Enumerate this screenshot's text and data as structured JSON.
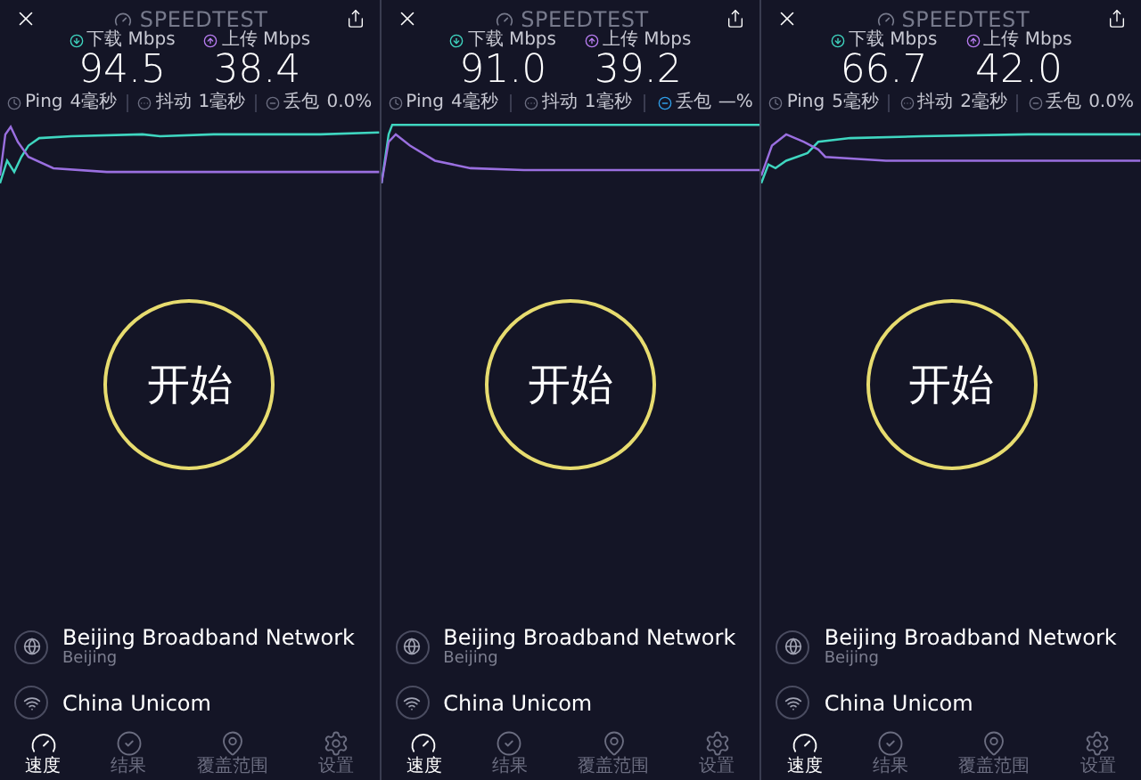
{
  "panels": [
    {
      "title": "SPEEDTEST",
      "download": {
        "label": "下载 Mbps",
        "value": "94.5"
      },
      "upload": {
        "label": "上传 Mbps",
        "value": "38.4"
      },
      "stats": [
        {
          "kind": "ping",
          "label": "Ping",
          "value": "4毫秒",
          "highlighted": false
        },
        {
          "kind": "jitter",
          "label": "抖动",
          "value": "1毫秒",
          "highlighted": false
        },
        {
          "kind": "loss",
          "label": "丢包",
          "value": "0.0%",
          "highlighted": false
        }
      ],
      "start_label": "开始",
      "providers": [
        {
          "kind": "server",
          "name": "Beijing Broadband Network",
          "location": "Beijing"
        },
        {
          "kind": "wifi",
          "name": "China Unicom"
        }
      ],
      "tabs": [
        {
          "kind": "speed",
          "label": "速度",
          "selected": true
        },
        {
          "kind": "results",
          "label": "结果",
          "selected": false
        },
        {
          "kind": "coverage",
          "label": "覆盖范围",
          "selected": false
        },
        {
          "kind": "settings",
          "label": "设置",
          "selected": false
        }
      ]
    },
    {
      "title": "SPEEDTEST",
      "download": {
        "label": "下载 Mbps",
        "value": "91.0"
      },
      "upload": {
        "label": "上传 Mbps",
        "value": "39.2"
      },
      "stats": [
        {
          "kind": "ping",
          "label": "Ping",
          "value": "4毫秒",
          "highlighted": false
        },
        {
          "kind": "jitter",
          "label": "抖动",
          "value": "1毫秒",
          "highlighted": false
        },
        {
          "kind": "loss",
          "label": "丢包",
          "value": "—%",
          "highlighted": true
        }
      ],
      "start_label": "开始",
      "providers": [
        {
          "kind": "server",
          "name": "Beijing Broadband Network",
          "location": "Beijing"
        },
        {
          "kind": "wifi",
          "name": "China Unicom"
        }
      ],
      "tabs": [
        {
          "kind": "speed",
          "label": "速度",
          "selected": true
        },
        {
          "kind": "results",
          "label": "结果",
          "selected": false
        },
        {
          "kind": "coverage",
          "label": "覆盖范围",
          "selected": false
        },
        {
          "kind": "settings",
          "label": "设置",
          "selected": false
        }
      ]
    },
    {
      "title": "SPEEDTEST",
      "download": {
        "label": "下载 Mbps",
        "value": "66.7"
      },
      "upload": {
        "label": "上传 Mbps",
        "value": "42.0"
      },
      "stats": [
        {
          "kind": "ping",
          "label": "Ping",
          "value": "5毫秒",
          "highlighted": false
        },
        {
          "kind": "jitter",
          "label": "抖动",
          "value": "2毫秒",
          "highlighted": false
        },
        {
          "kind": "loss",
          "label": "丢包",
          "value": "0.0%",
          "highlighted": false
        }
      ],
      "start_label": "开始",
      "providers": [
        {
          "kind": "server",
          "name": "Beijing Broadband Network",
          "location": "Beijing"
        },
        {
          "kind": "wifi",
          "name": "China Unicom"
        }
      ],
      "tabs": [
        {
          "kind": "speed",
          "label": "速度",
          "selected": true
        },
        {
          "kind": "results",
          "label": "结果",
          "selected": false
        },
        {
          "kind": "coverage",
          "label": "覆盖范围",
          "selected": false
        },
        {
          "kind": "settings",
          "label": "设置",
          "selected": false
        }
      ]
    }
  ]
}
